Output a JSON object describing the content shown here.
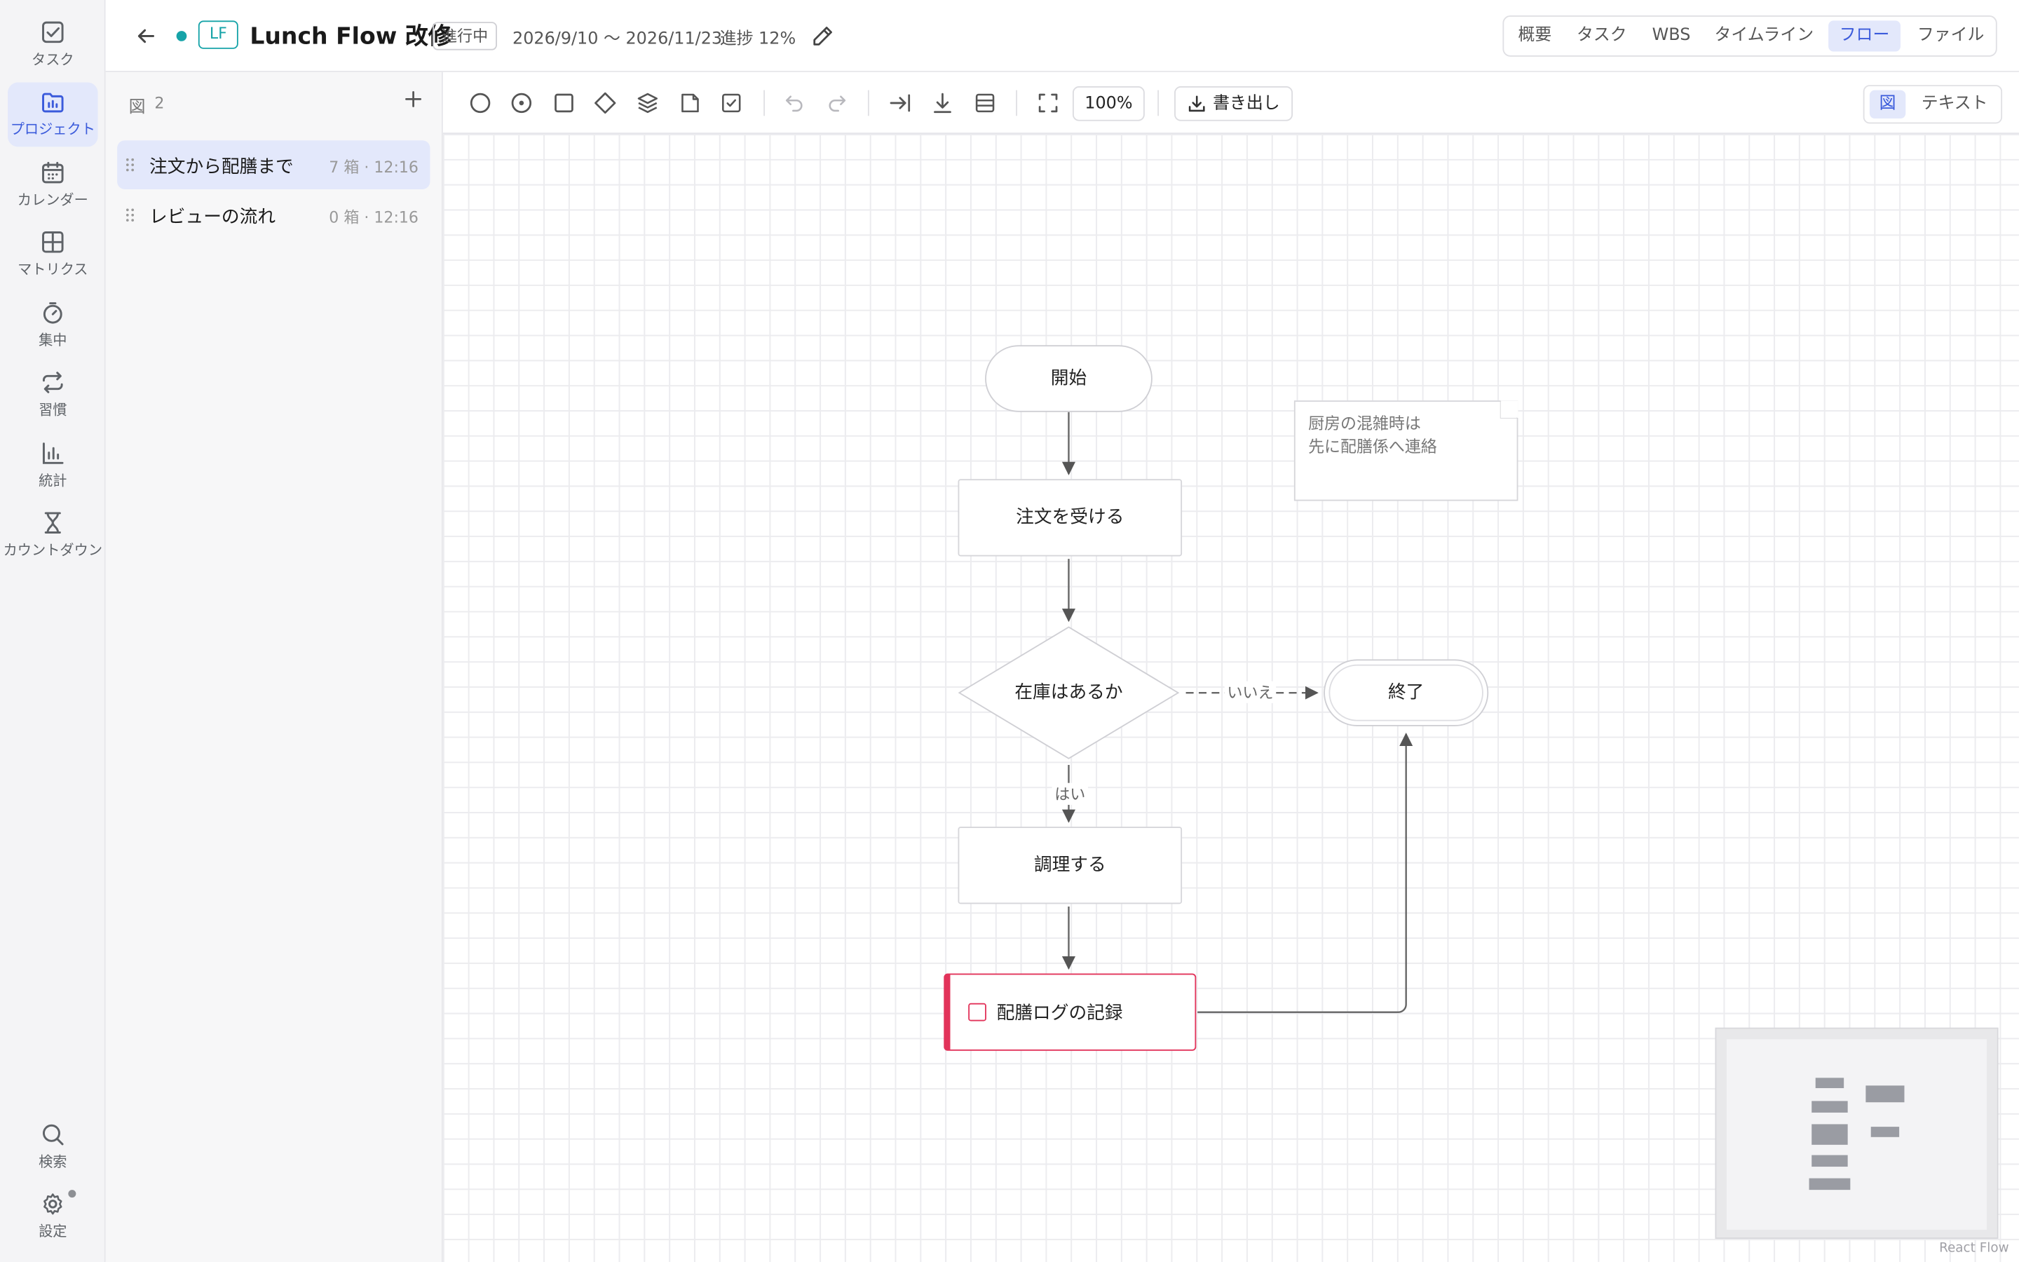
{
  "nav": {
    "items": [
      {
        "id": "tasks",
        "label": "タスク",
        "icon": "checkbox-icon",
        "active": false
      },
      {
        "id": "projects",
        "label": "プロジェクト",
        "icon": "project-icon",
        "active": true
      },
      {
        "id": "calendar",
        "label": "カレンダー",
        "icon": "calendar-icon",
        "active": false
      },
      {
        "id": "matrix",
        "label": "マトリクス",
        "icon": "grid-icon",
        "active": false
      },
      {
        "id": "focus",
        "label": "集中",
        "icon": "timer-icon",
        "active": false
      },
      {
        "id": "habits",
        "label": "習慣",
        "icon": "repeat-icon",
        "active": false
      },
      {
        "id": "stats",
        "label": "統計",
        "icon": "bar-chart-icon",
        "active": false
      },
      {
        "id": "countdown",
        "label": "カウントダウン",
        "icon": "hourglass-icon",
        "active": false
      }
    ],
    "search_label": "検索",
    "settings_label": "設定"
  },
  "header": {
    "badge": "LF",
    "title": "Lunch Flow 改修",
    "status": "進行中",
    "dates": "2026/9/10 〜 2026/11/23",
    "progress": "進捗 12%",
    "progress_value": 0.12,
    "tabs": [
      {
        "label": "概要",
        "active": false
      },
      {
        "label": "タスク",
        "active": false
      },
      {
        "label": "WBS",
        "active": false
      },
      {
        "label": "タイムライン",
        "active": false
      },
      {
        "label": "フロー",
        "active": true
      },
      {
        "label": "ファイル",
        "active": false
      }
    ]
  },
  "diagrams": {
    "header_icon": "図",
    "count": "2",
    "items": [
      {
        "name": "注文から配膳まで",
        "meta": "7 箱 · 12:16",
        "active": true
      },
      {
        "name": "レビューの流れ",
        "meta": "0 箱 · 12:16",
        "active": false
      }
    ]
  },
  "toolbar": {
    "zoom": "100%",
    "export_label": "書き出し",
    "view_modes": [
      {
        "label": "図",
        "active": true
      },
      {
        "label": "テキスト",
        "active": false
      }
    ]
  },
  "flow": {
    "nodes": {
      "start": "開始",
      "receive": "注文を受ける",
      "decision": "在庫はあるか",
      "end": "終了",
      "cook": "調理する",
      "task": "配膳ログの記録"
    },
    "note": "厨房の混雑時は\n先に配膳係へ連絡",
    "edge_labels": {
      "no": "いいえ",
      "yes": "はい"
    }
  },
  "attribution": "React Flow",
  "colors": {
    "accent": "#3b5bdb",
    "accent_bg": "#e3e8fb",
    "teal": "#16a3a8",
    "task_red": "#e2335a"
  }
}
